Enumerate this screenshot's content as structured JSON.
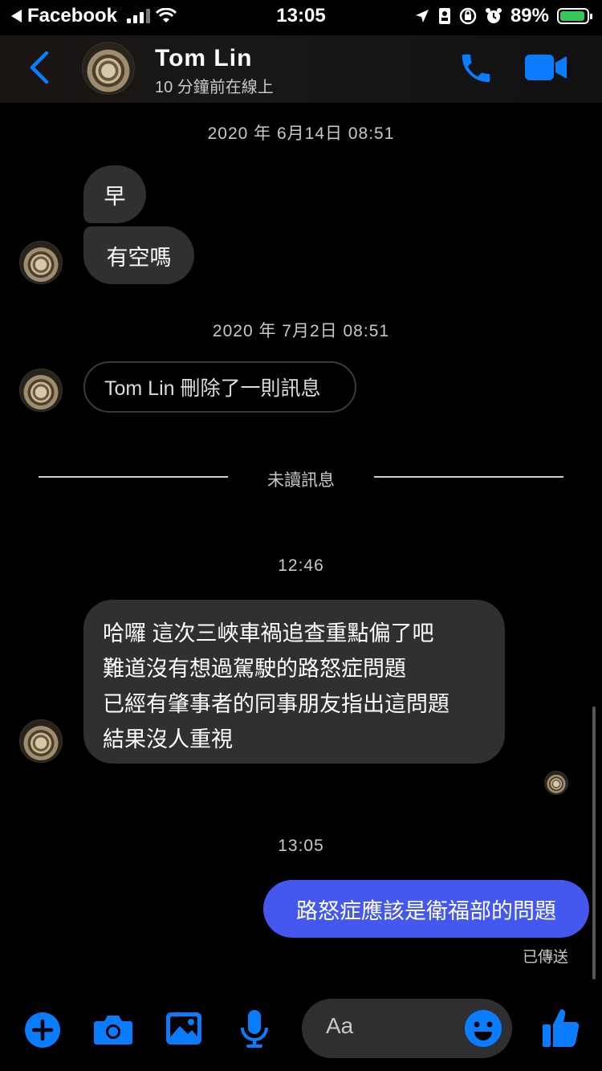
{
  "status_bar": {
    "back_app": "Facebook",
    "time": "13:05",
    "battery_percent": "89%"
  },
  "header": {
    "contact_name": "Tom  Lin",
    "presence": "10 分鐘前在線上"
  },
  "conversation": {
    "timestamp_1": "2020 年 6月14日 08:51",
    "msg_1": "早",
    "msg_2": "有空嗎",
    "timestamp_2": "2020 年 7月2日 08:51",
    "deleted_notice": "Tom  Lin 刪除了一則訊息",
    "unread_label": "未讀訊息",
    "timestamp_3": "12:46",
    "msg_3_lines": [
      "哈囉 這次三峽車禍追查重點偏了吧",
      "難道沒有想過駕駛的路怒症問題",
      "已經有肇事者的同事朋友指出這問題",
      "結果沒人重視"
    ],
    "timestamp_4": "13:05",
    "msg_4_outgoing": "路怒症應該是衛福部的問題",
    "sent_status": "已傳送"
  },
  "composer": {
    "placeholder": "Aa"
  },
  "colors": {
    "accent": "#0a7cff",
    "outgoing_bubble": "#4458f0",
    "incoming_bubble": "#303030"
  }
}
